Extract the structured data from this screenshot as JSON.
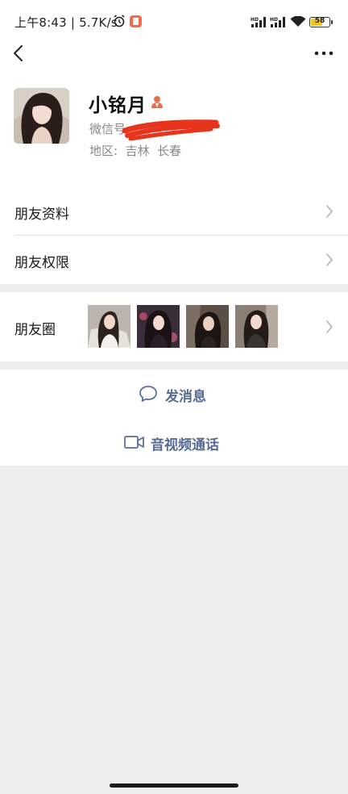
{
  "status_bar": {
    "time_speed": "上午8:43 | 5.7K/s",
    "battery": "58",
    "icons": [
      "alarm-icon",
      "app-notification-icon",
      "hd-signal-icon",
      "hd-signal-icon",
      "wifi-icon",
      "battery-icon"
    ]
  },
  "nav": {
    "back_icon": "chevron-left-icon",
    "more_icon": "more-dots-icon"
  },
  "profile": {
    "name": "小铭月",
    "wechat_id_label": "微信号:",
    "region": "地区:  吉林  长春"
  },
  "menu": {
    "friend_info": "朋友资料",
    "friend_permissions": "朋友权限",
    "moments": "朋友圈"
  },
  "actions": {
    "send_message": "发消息",
    "video_call": "音视频通话"
  },
  "colors": {
    "link_blue": "#576b95",
    "background_gray": "#ededed",
    "redaction_red": "#e8341c"
  }
}
